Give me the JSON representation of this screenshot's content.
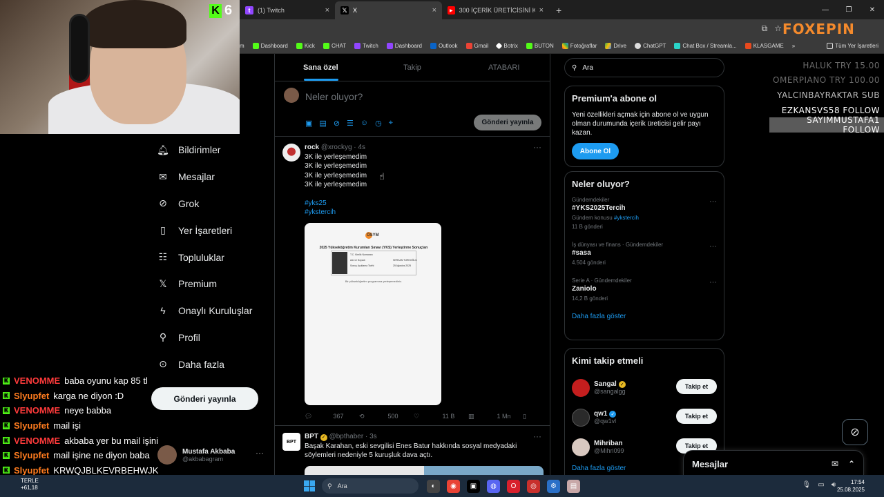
{
  "browser": {
    "tabs": [
      {
        "title": "(1) Twitch",
        "icon": "twitch-icon",
        "color": "#9146ff",
        "active": false
      },
      {
        "title": "X",
        "icon": "x-icon",
        "color": "#000000",
        "active": true
      },
      {
        "title": "300 İÇERİK ÜRETİCİSİNİ KANDI",
        "icon": "youtube-icon",
        "color": "#ff0000",
        "active": false
      }
    ],
    "bookmarks": [
      "Dashboard",
      "Kick",
      "CHAT",
      "Twitch",
      "Dashboard",
      "Outlook",
      "Gmail",
      "Botrix",
      "BUTON",
      "Fotoğraflar",
      "Drive",
      "ChatGPT",
      "Chat Box / Streamla...",
      "KLASGAME"
    ],
    "bookmarks_first_partial": "m",
    "bookmarks_more": "»",
    "bookmarks_all": "Tüm Yer İşaretleri",
    "logo": "FOXEPIN"
  },
  "webcam": {
    "kick_count": "6"
  },
  "nav": {
    "items": [
      {
        "label": "Bildirimler",
        "icon": "bell-icon"
      },
      {
        "label": "Mesajlar",
        "icon": "envelope-icon"
      },
      {
        "label": "Grok",
        "icon": "grok-icon"
      },
      {
        "label": "Yer İşaretleri",
        "icon": "bookmark-icon"
      },
      {
        "label": "Topluluklar",
        "icon": "people-icon"
      },
      {
        "label": "Premium",
        "icon": "x-logo-icon"
      },
      {
        "label": "Onaylı Kuruluşlar",
        "icon": "lightning-icon"
      },
      {
        "label": "Profil",
        "icon": "person-icon"
      },
      {
        "label": "Daha fazla",
        "icon": "more-circle-icon"
      }
    ],
    "post_button": "Gönderi yayınla",
    "account": {
      "name": "Mustafa Akbaba",
      "handle": "@akbabagram"
    }
  },
  "chat": [
    {
      "user": "VENOMME",
      "color": "#ff3b3b",
      "msg": "baba oyunu kap 85 tl"
    },
    {
      "user": "Slyupfet",
      "color": "#ff7c1f",
      "msg": "karga ne diyon :D"
    },
    {
      "user": "VENOMME",
      "color": "#ff3b3b",
      "msg": "neye babba"
    },
    {
      "user": "Slyupfet",
      "color": "#ff7c1f",
      "msg": "mail işi"
    },
    {
      "user": "VENOMME",
      "color": "#ff3b3b",
      "msg": "akbaba yer bu mail işini"
    },
    {
      "user": "Slyupfet",
      "color": "#ff7c1f",
      "msg": "mail işine ne diyon baba"
    },
    {
      "user": "Slyupfet",
      "color": "#ff7c1f",
      "msg": "KRWQJBLKEVRBEHWJK"
    },
    {
      "user": "VENOMME",
      "color": "#ff3b3b",
      "msg": "baba oyunu alıyonmu 85 tl amk"
    }
  ],
  "feed": {
    "tabs": [
      "Sana özel",
      "Takip",
      "ATABARI"
    ],
    "compose_placeholder": "Neler oluyor?",
    "compose_button": "Gönderi yayınla",
    "tweet1": {
      "name": "rock",
      "handle": "@xrockyg",
      "time": "· 4s",
      "lines": [
        "3K ile yerleşemedim",
        "3K ile yerleşemedim",
        "3K ile yerleşemedim",
        "3K ile yerleşemedim"
      ],
      "tags": [
        "#yks25",
        "#ykstercih"
      ],
      "media": {
        "brand": "ÖSYM",
        "title": "2025 Yükseköğretim Kurumları Sınavı (YKS) Yerleştirme Sonuçları",
        "rows": [
          "T.C. Kimlik Numarası",
          "Adı ve Soyadı",
          "Sonuç Açıklama Tarihi"
        ],
        "name_value": "SERKAN TÜRKOĞLU",
        "date_value": "25 Ağustos 2025",
        "note": "Bir yükseköğretim programına yerleşemediniz."
      },
      "replies": "367",
      "reposts": "500",
      "likes": "11 B",
      "views": "1 Mn"
    },
    "tweet2": {
      "name": "BPT",
      "handle": "@bpthaber",
      "time": "· 3s",
      "text": "Başak Karahan, eski sevgilisi Enes Batur hakkında sosyal medyadaki söylemleri nedeniyle 5 kuruşluk dava açtı."
    }
  },
  "right": {
    "search_placeholder": "Ara",
    "premium": {
      "title": "Premium'a abone ol",
      "text": "Yeni özellikleri açmak için abone ol ve uygun olman durumunda içerik üreticisi gelir payı kazan.",
      "button": "Abone Ol"
    },
    "trends_title": "Neler oluyor?",
    "trends": [
      {
        "cat": "Gündemdekiler",
        "name": "#YKS2025Tercih",
        "topic_prefix": "Gündem konusu",
        "topic_tag": "#ykstercih",
        "count": "11 B gönderi"
      },
      {
        "cat": "İş dünyası ve finans · Gündemdekiler",
        "name": "#sasa",
        "count": "4.504 gönderi"
      },
      {
        "cat": "Serie A · Gündemdekiler",
        "name": "Zaniolo",
        "count": "14,2 B gönderi"
      }
    ],
    "show_more": "Daha fazla göster",
    "who_title": "Kimi takip etmeli",
    "who": [
      {
        "name": "Sangal",
        "handle": "@sangalgg",
        "badge": "gold",
        "avcolor": "#c41e1e"
      },
      {
        "name": "qw1",
        "handle": "@qw1vl",
        "badge": "blue",
        "avcolor": "#2a2a2a"
      },
      {
        "name": "Mihriban",
        "handle": "@Mihri099",
        "badge": "",
        "avcolor": "#d8c8c0"
      }
    ],
    "follow_label": "Takip et",
    "who_more": "Daha fazla göster"
  },
  "overlay": [
    {
      "text": "HALUK   TRY 15.00",
      "color": "#6b6b6b",
      "bg": "transparent"
    },
    {
      "text": "OMERPIANO   TRY 100.00",
      "color": "#6b6b6b",
      "bg": "transparent"
    },
    {
      "text": "YALCINBAYRAKTAR   SUB",
      "color": "#bdbdbd",
      "bg": "transparent"
    },
    {
      "text": "EZKANSVS58   FOLLOW",
      "color": "#ffffff",
      "bg": "transparent"
    },
    {
      "text": "SAYIMMUSTAFA1   FOLLOW",
      "color": "#ffffff",
      "bg": "#5a5a5a"
    }
  ],
  "messages_dock": {
    "title": "Mesajlar"
  },
  "taskbar": {
    "weather_top": "TERLE",
    "weather_bottom": "+61,18",
    "search": "Ara",
    "time": "17:54",
    "date": "25.08.2025"
  }
}
